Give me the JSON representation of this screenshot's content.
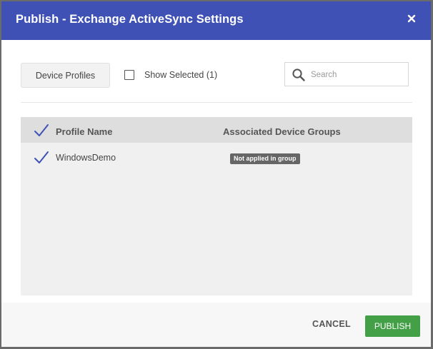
{
  "dialog": {
    "title": "Publish - Exchange ActiveSync Settings",
    "close_icon": "close-icon"
  },
  "toolbar": {
    "device_profiles_label": "Device Profiles",
    "show_selected_label": "Show Selected (1)",
    "show_selected_checked": false
  },
  "search": {
    "placeholder": "Search",
    "value": ""
  },
  "table": {
    "columns": [
      "Profile Name",
      "Associated Device Groups"
    ],
    "rows": [
      {
        "profile_name": "WindowsDemo",
        "device_groups_badge": "Not applied in group",
        "selected": true
      }
    ]
  },
  "footer": {
    "cancel_label": "CANCEL",
    "publish_label": "PUBLISH"
  },
  "colors": {
    "header": "#3f51b5",
    "publish": "#43a047",
    "check": "#3f51b5"
  }
}
